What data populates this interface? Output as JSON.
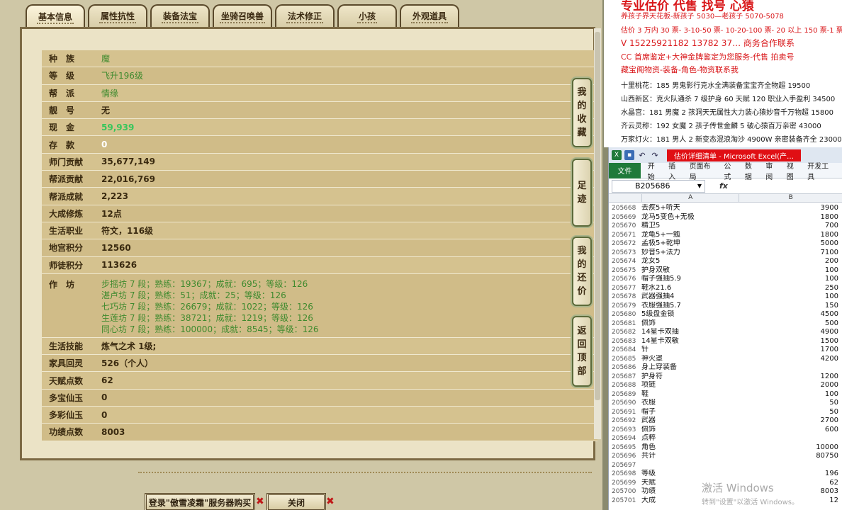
{
  "tabs": [
    "基本信息",
    "属性抗性",
    "装备法宝",
    "坐骑召唤兽",
    "法术修正",
    "小孩",
    "外观道具"
  ],
  "info_rows": [
    {
      "label": "种　族",
      "value": "魔",
      "style": "green"
    },
    {
      "label": "等　级",
      "value": "飞升196级",
      "style": "green"
    },
    {
      "label": "帮　派",
      "value": "情缘",
      "style": "green"
    },
    {
      "label": "靓　号",
      "value": "无",
      "style": "dark"
    },
    {
      "label": "现　金",
      "value": "59,939",
      "style": "lime"
    },
    {
      "label": "存　款",
      "value": "0",
      "style": "white"
    },
    {
      "label": "师门贡献",
      "value": "35,677,149",
      "style": "dark"
    },
    {
      "label": "帮派贡献",
      "value": "22,016,769",
      "style": "dark"
    },
    {
      "label": "帮派成就",
      "value": "2,223",
      "style": "dark"
    },
    {
      "label": "大成修炼",
      "value": "12点",
      "style": "dark"
    },
    {
      "label": "生活职业",
      "value": "符文，116级",
      "style": "dark"
    },
    {
      "label": "地宫积分",
      "value": "12560",
      "style": "dark"
    },
    {
      "label": "师徒积分",
      "value": "113626",
      "style": "dark"
    }
  ],
  "craft": {
    "label": "作　坊",
    "lines": [
      "步摇坊 7 段；熟练：19367；成就：695；等级：126",
      "湛卢坊 7 段；熟练：51；成就：25；等级：126",
      "七巧坊 7 段；熟练：26679；成就：1022；等级：126",
      "生莲坊 7 段；熟练：38721；成就：1219；等级：126",
      "同心坊 7 段；熟练：100000；成就：8545；等级：126"
    ]
  },
  "info_rows_2": [
    {
      "label": "生活技能",
      "value": "炼气之术 1级;",
      "style": "dark"
    },
    {
      "label": "家具回灵",
      "value": "526（个人）",
      "style": "dark"
    },
    {
      "label": "天赋点数",
      "value": "62",
      "style": "dark"
    },
    {
      "label": "多宝仙玉",
      "value": "0",
      "style": "dark"
    },
    {
      "label": "多彩仙玉",
      "value": "0",
      "style": "dark"
    },
    {
      "label": "功绩点数",
      "value": "8003",
      "style": "dark"
    }
  ],
  "side_buttons": [
    "我的收藏",
    "足迹",
    "我的还价",
    "返回顶部"
  ],
  "bottom_buttons": {
    "login": "登录\"傲雪凌霜\"服务器购买",
    "close": "关闭"
  },
  "notice": {
    "top": "专业估价 代售 找号 心猿",
    "lines_red": [
      "养孩子界天花板-新孩子 5030—老孩子 5070-5078",
      "估价 3 万内 30 票- 3-10-50 票- 10-20-100 票- 20 以上 150 票-1 票",
      "V 15225921182     13782 37… 商务合作联系",
      "CC 首席鉴定+大神金牌鉴定为您服务-代售 拍卖号",
      "藏宝阁物资-装备-角色-物资联系我"
    ],
    "lines_dark": [
      "十里桃花：185 男鬼影行克水全满装备宝宝齐全物超 19500",
      "山西新区：克火队通杀 7 级护身 60 天赋 120 职业入手盈利 34500",
      "水晶宫：181 男魔 2 孩洞天无属性大力装心猿妙音千万物超 15800",
      "齐云灵称：192 女魔 2 孩子传世金麟 5 破心猿百万亲密 43000",
      "万家灯火：181 男人 2 新变态混浪淘沙 4900W 亲密装备齐全 23000"
    ]
  },
  "excel": {
    "title": "估价详细清单 - Microsoft Excel(产…",
    "file_tab": "文件",
    "ribbon_tabs": [
      "开始",
      "插入",
      "页面布局",
      "公式",
      "数据",
      "审阅",
      "视图",
      "开发工具"
    ],
    "namebox": "B205686",
    "fx": "fx",
    "col_a": "A",
    "col_b": "B",
    "rows": [
      [
        "205668",
        "去疾5+听天",
        "3900"
      ],
      [
        "205669",
        "龙马5变色+无极",
        "1800"
      ],
      [
        "205670",
        "精卫5",
        "700"
      ],
      [
        "205671",
        "龙龟5+一瓢",
        "1800"
      ],
      [
        "205672",
        "孟极5+乾坤",
        "5000"
      ],
      [
        "205673",
        "妙音5+法力",
        "7100"
      ],
      [
        "205674",
        "龙女5",
        "200"
      ],
      [
        "205675",
        "护身双敏",
        "100"
      ],
      [
        "205676",
        "帽子强抽5.9",
        "100"
      ],
      [
        "205677",
        "鞋水21.6",
        "250"
      ],
      [
        "205678",
        "武器强抽4",
        "100"
      ],
      [
        "205679",
        "衣服强抽5.7",
        "150"
      ],
      [
        "205680",
        "5级盘金锁",
        "4500"
      ],
      [
        "205681",
        "佩饰",
        "500"
      ],
      [
        "205682",
        "14星卡双抽",
        "4900"
      ],
      [
        "205683",
        "14星卡双敏",
        "1500"
      ],
      [
        "205684",
        "针",
        "1700"
      ],
      [
        "205685",
        "神火罩",
        "4200"
      ],
      [
        "205686",
        "身上穿装备",
        ""
      ],
      [
        "205687",
        "护身符",
        "1200"
      ],
      [
        "205688",
        "项链",
        "2000"
      ],
      [
        "205689",
        "鞋",
        "100"
      ],
      [
        "205690",
        "衣服",
        "50"
      ],
      [
        "205691",
        "帽子",
        "50"
      ],
      [
        "205692",
        "武器",
        "2700"
      ],
      [
        "205693",
        "佩饰",
        "600"
      ],
      [
        "205694",
        "点粹",
        ""
      ],
      [
        "205695",
        "角色",
        "10000"
      ],
      [
        "205696",
        "共计",
        "80750"
      ],
      [
        "205697",
        "",
        ""
      ],
      [
        "205698",
        "等级",
        "196"
      ],
      [
        "205699",
        "天赋",
        "62"
      ],
      [
        "205700",
        "功绩",
        "8003"
      ],
      [
        "205701",
        "大成",
        "12"
      ]
    ]
  },
  "watermark": {
    "line1": "激活 Windows",
    "line2": "转到\"设置\"以激活 Windows。"
  }
}
